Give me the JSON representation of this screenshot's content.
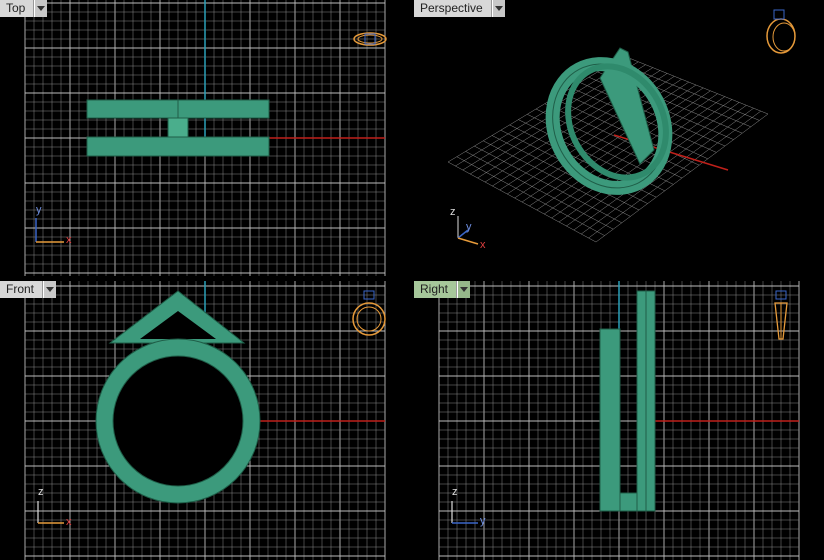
{
  "viewports": [
    {
      "id": "top",
      "label": "Top",
      "active": false,
      "axes": {
        "h": "x",
        "v": "y"
      }
    },
    {
      "id": "perspective",
      "label": "Perspective",
      "active": false,
      "axes": {
        "h": "x",
        "v": "y",
        "up": "z"
      }
    },
    {
      "id": "front",
      "label": "Front",
      "active": false,
      "axes": {
        "h": "x",
        "v": "z"
      }
    },
    {
      "id": "right",
      "label": "Right",
      "active": true,
      "axes": {
        "h": "y",
        "v": "z"
      }
    }
  ],
  "colors": {
    "grid": "#8a8a8a",
    "grid_major": "#bdbdbd",
    "x_axis": "#c0201a",
    "y_axis": "#2aa0b8",
    "model_fill": "#3c9a7c",
    "model_edge": "#1f5e48",
    "tab_bg": "#d8d8d8",
    "tab_active_bg": "#a6c79a",
    "widget_orange": "#e69a3a",
    "widget_blue": "#3a66c8"
  },
  "icons": {
    "dropdown": "triangle-down-icon",
    "axis_widget": "axis-triad-icon",
    "orientation_widget": "ring-preview-icon"
  }
}
